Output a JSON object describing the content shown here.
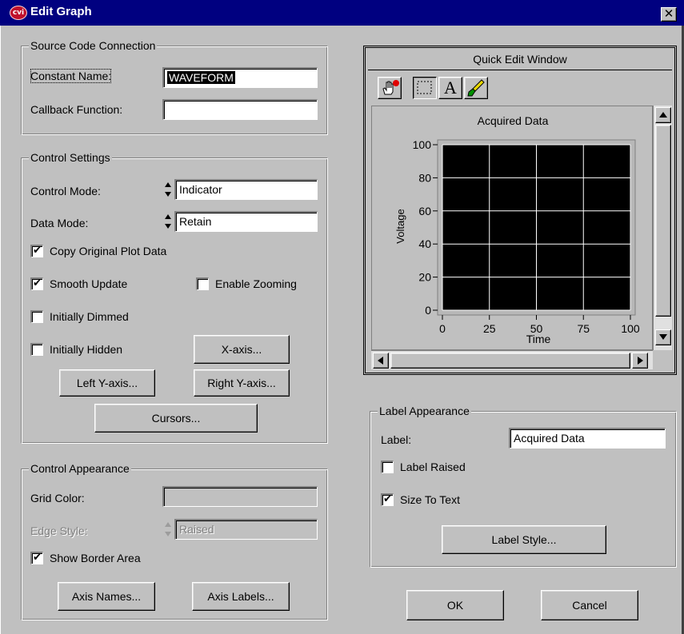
{
  "window": {
    "title": "Edit Graph",
    "logo_text": "cvi",
    "close_glyph": "✕"
  },
  "source_code": {
    "title": "Source Code Connection",
    "constant_name_label": "Constant Name:",
    "constant_name_value": "WAVEFORM",
    "callback_label": "Callback Function:",
    "callback_value": ""
  },
  "control_settings": {
    "title": "Control Settings",
    "control_mode_label": "Control Mode:",
    "control_mode_value": "Indicator",
    "data_mode_label": "Data Mode:",
    "data_mode_value": "Retain",
    "copy_original_label": "Copy Original Plot Data",
    "copy_original_checked": true,
    "smooth_update_label": "Smooth Update",
    "smooth_update_checked": true,
    "enable_zooming_label": "Enable Zooming",
    "enable_zooming_checked": false,
    "initially_dimmed_label": "Initially Dimmed",
    "initially_dimmed_checked": false,
    "initially_hidden_label": "Initially Hidden",
    "initially_hidden_checked": false,
    "x_axis_button": "X-axis...",
    "left_y_axis_button": "Left Y-axis...",
    "right_y_axis_button": "Right Y-axis...",
    "cursors_button": "Cursors..."
  },
  "control_appearance": {
    "title": "Control Appearance",
    "grid_color_label": "Grid Color:",
    "edge_style_label": "Edge Style:",
    "edge_style_value": "Raised",
    "show_border_label": "Show Border Area",
    "show_border_checked": true,
    "axis_names_button": "Axis Names...",
    "axis_labels_button": "Axis Labels..."
  },
  "quick_edit": {
    "title": "Quick Edit Window",
    "tools": [
      "hand-pointer-icon",
      "selection-rect-icon",
      "text-tool-icon",
      "paint-brush-icon"
    ],
    "text_tool_glyph": "A"
  },
  "chart_data": {
    "type": "line",
    "title": "Acquired Data",
    "xlabel": "Time",
    "ylabel": "Voltage",
    "xlim": [
      0,
      100
    ],
    "ylim": [
      0,
      100
    ],
    "x_ticks": [
      "0",
      "25",
      "50",
      "75",
      "100"
    ],
    "y_ticks": [
      "0",
      "20",
      "40",
      "60",
      "80",
      "100"
    ],
    "grid": true,
    "plot_background": "#000000",
    "grid_color": "#ffffff",
    "series": []
  },
  "label_appearance": {
    "title": "Label Appearance",
    "label_label": "Label:",
    "label_value": "Acquired Data",
    "label_raised_label": "Label Raised",
    "label_raised_checked": false,
    "size_to_text_label": "Size To Text",
    "size_to_text_checked": true,
    "label_style_button": "Label Style..."
  },
  "footer": {
    "ok_button": "OK",
    "cancel_button": "Cancel"
  },
  "check_glyph": "✔"
}
